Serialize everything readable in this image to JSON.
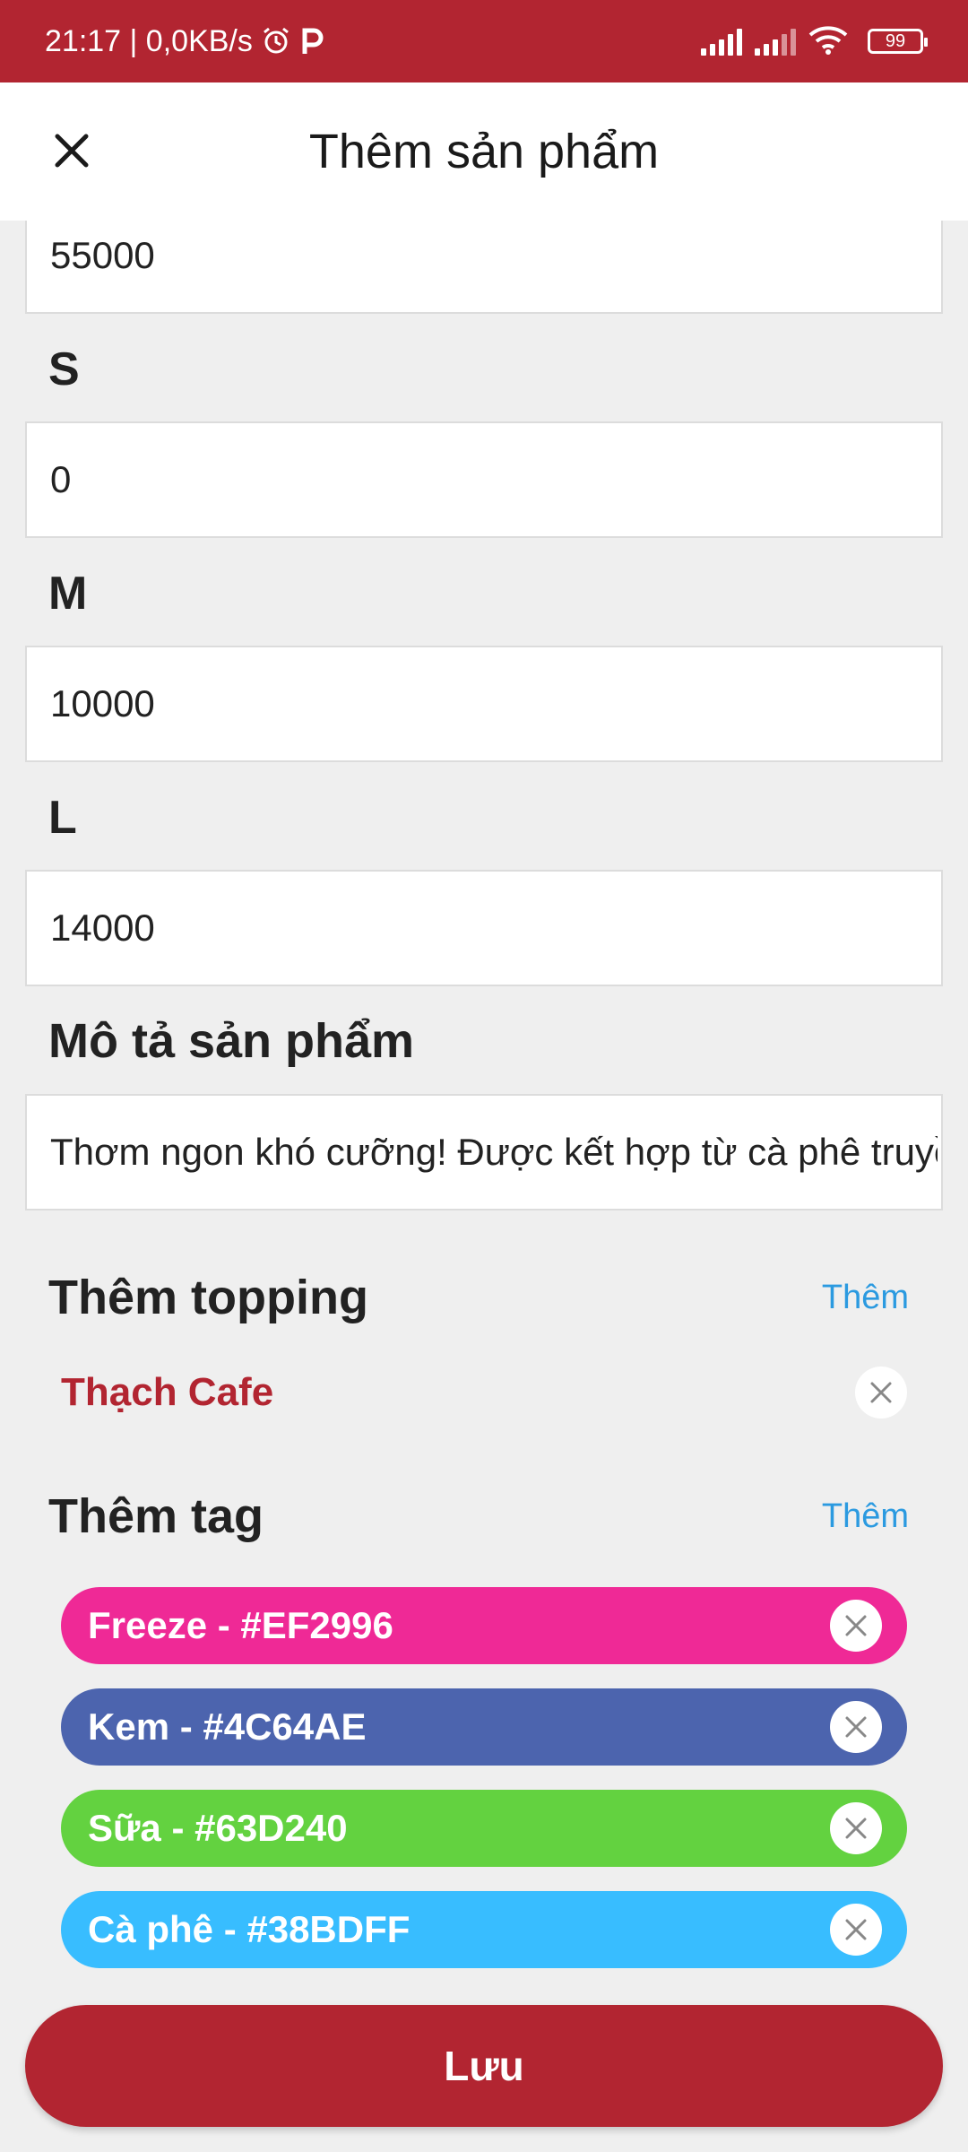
{
  "status_bar": {
    "time_speed": "21:17 | 0,0KB/s",
    "battery": "99"
  },
  "app_bar": {
    "title": "Thêm sản phẩm"
  },
  "form": {
    "price_value": "55000",
    "size_s_label": "S",
    "size_s_value": "0",
    "size_m_label": "M",
    "size_m_value": "10000",
    "size_l_label": "L",
    "size_l_value": "14000",
    "description_label": "Mô tả sản phẩm",
    "description_value": "Thơm ngon khó cưỡng! Được kết hợp từ cà phê truyền thống"
  },
  "topping": {
    "title": "Thêm topping",
    "add_label": "Thêm",
    "items": [
      {
        "name": "Thạch Cafe"
      }
    ]
  },
  "tags": {
    "title": "Thêm tag",
    "add_label": "Thêm",
    "items": [
      {
        "label": "Freeze - #EF2996",
        "color": "#EF2996"
      },
      {
        "label": "Kem - #4C64AE",
        "color": "#4C64AE"
      },
      {
        "label": "Sữa - #63D240",
        "color": "#63D240"
      },
      {
        "label": "Cà phê - #38BDFF",
        "color": "#38BDFF"
      }
    ]
  },
  "save_button": {
    "label": "Lưu"
  },
  "colors": {
    "primary": "#b22531",
    "link": "#2b9ae0"
  }
}
